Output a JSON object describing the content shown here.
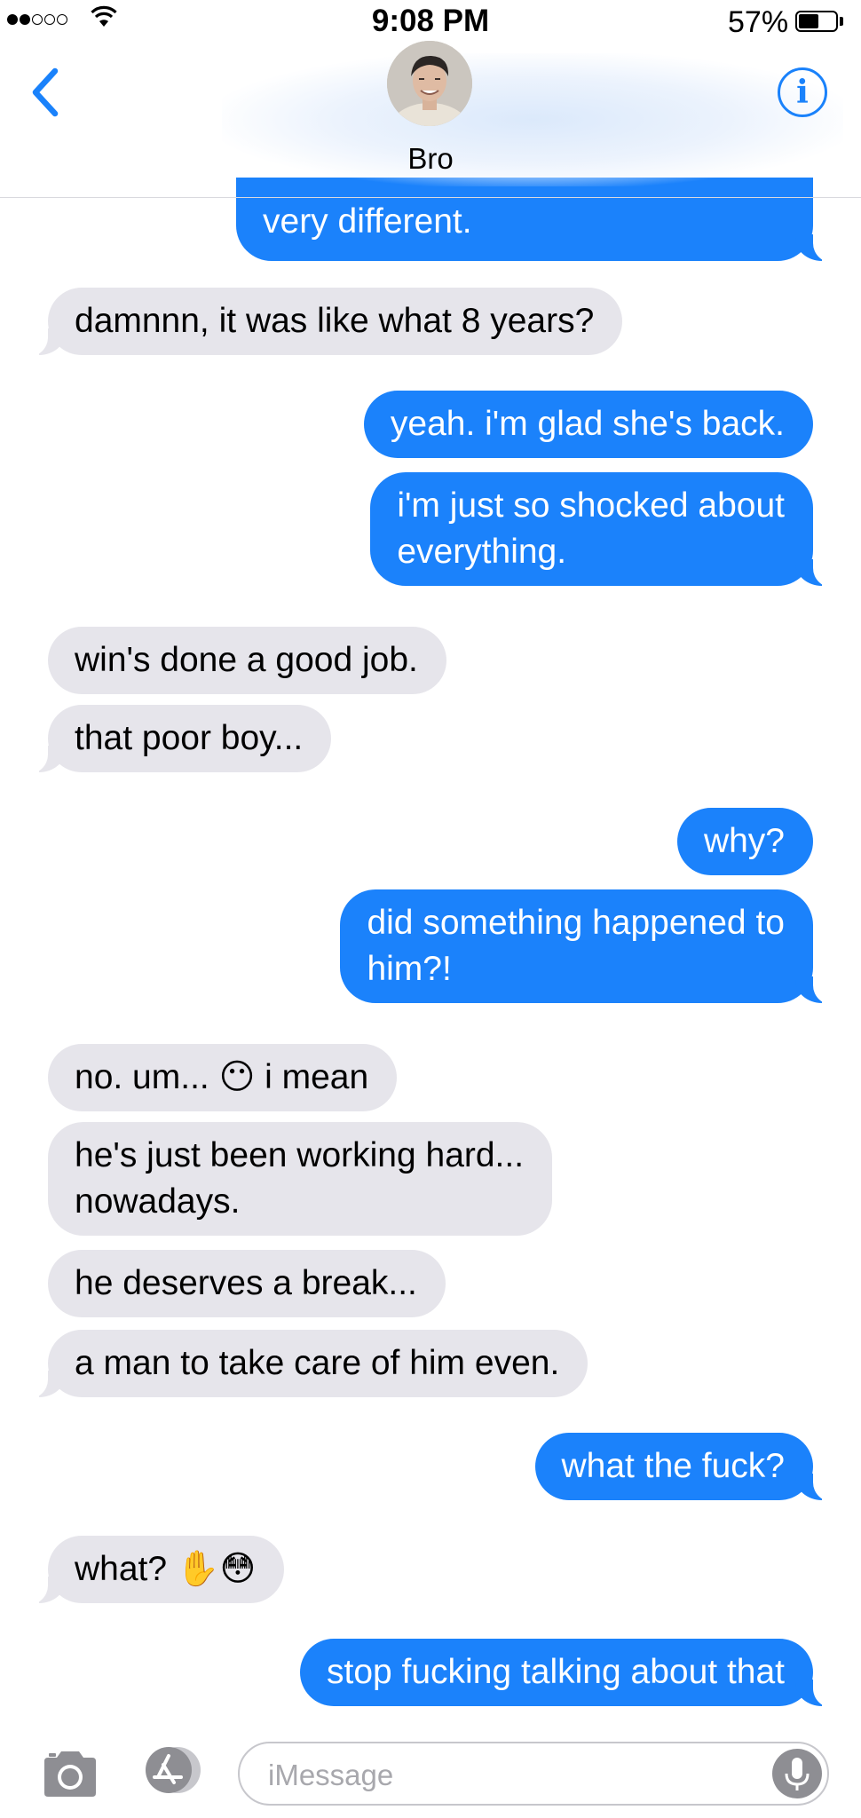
{
  "status_bar": {
    "time": "9:08 PM",
    "battery_percent": "57%",
    "battery_level": 0.57,
    "signal_bars_filled": 2,
    "signal_bars_total": 5
  },
  "header": {
    "contact_name": "Bro",
    "avatar_icon": "contact-avatar-photo",
    "back_icon": "chevron-left-icon",
    "info_icon": "info-icon",
    "info_glyph": "i"
  },
  "messages": [
    {
      "dir": "sent",
      "text": "very different."
    },
    {
      "dir": "received",
      "text": "damnnn, it was like what 8 years?"
    },
    {
      "dir": "sent",
      "text": "yeah. i'm glad she's back."
    },
    {
      "dir": "sent",
      "text": "i'm just so shocked about",
      "text2": "everything."
    },
    {
      "dir": "received",
      "text": "win's done a good job."
    },
    {
      "dir": "received",
      "text": "that poor boy..."
    },
    {
      "dir": "sent",
      "text": "why?"
    },
    {
      "dir": "sent",
      "text": "did something happened to",
      "text2": "him?!"
    },
    {
      "dir": "received",
      "text": "no. um... ",
      "emoji": "😶",
      "text_after": " i mean"
    },
    {
      "dir": "received",
      "text": "he's just been working hard...",
      "text2": "nowadays."
    },
    {
      "dir": "received",
      "text": "he deserves a break..."
    },
    {
      "dir": "received",
      "text": "a man to take care of him even."
    },
    {
      "dir": "sent",
      "text": "what the fuck?"
    },
    {
      "dir": "received",
      "text": "what? ",
      "emoji": "✋😳"
    },
    {
      "dir": "sent",
      "text": "stop fucking talking about that"
    }
  ],
  "input_bar": {
    "placeholder": "iMessage",
    "camera_icon": "camera-icon",
    "appstore_icon": "app-store-icon",
    "mic_icon": "microphone-icon"
  },
  "colors": {
    "sent_bubble": "#1b82fb",
    "received_bubble": "#e6e5eb",
    "accent": "#1a82fb"
  }
}
